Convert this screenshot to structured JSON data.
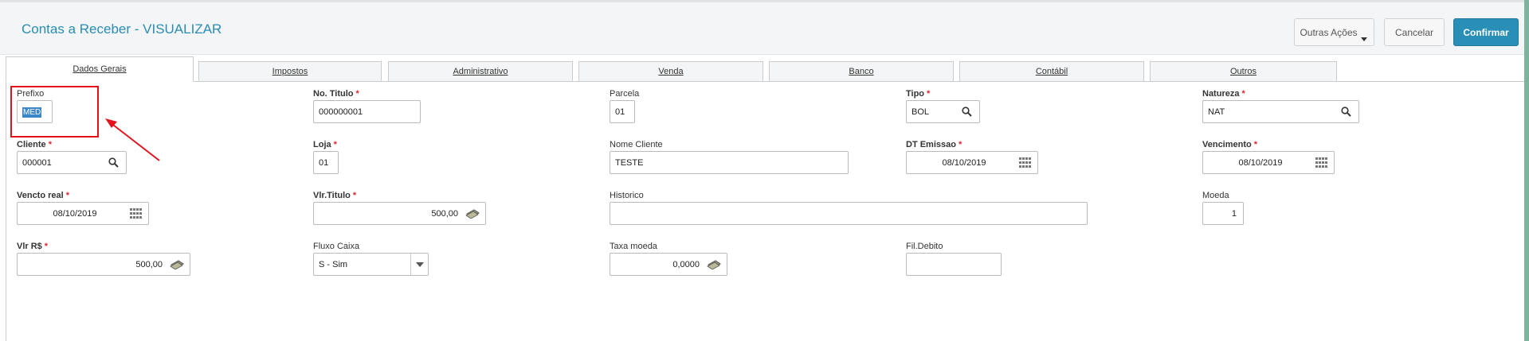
{
  "header": {
    "title": "Contas a Receber - VISUALIZAR",
    "outras_acoes": "Outras Ações",
    "cancelar": "Cancelar",
    "confirmar": "Confirmar"
  },
  "tabs": [
    {
      "label": "Dados Gerais",
      "active": true
    },
    {
      "label": "Impostos"
    },
    {
      "label": "Administrativo"
    },
    {
      "label": "Venda"
    },
    {
      "label": "Banco"
    },
    {
      "label": "Contábil"
    },
    {
      "label": "Outros"
    }
  ],
  "form": {
    "prefixo": {
      "label": "Prefixo",
      "value": "MED"
    },
    "no_titulo": {
      "label": "No. Titulo",
      "value": "000000001",
      "required": true
    },
    "parcela": {
      "label": "Parcela",
      "value": "01"
    },
    "tipo": {
      "label": "Tipo",
      "value": "BOL",
      "required": true,
      "icon": "search-icon"
    },
    "natureza": {
      "label": "Natureza",
      "value": "NAT",
      "required": true,
      "icon": "search-icon"
    },
    "cliente": {
      "label": "Cliente",
      "value": "000001",
      "required": true,
      "icon": "search-icon"
    },
    "loja": {
      "label": "Loja",
      "value": "01",
      "required": true
    },
    "nome_cliente": {
      "label": "Nome Cliente",
      "value": "TESTE"
    },
    "dt_emissao": {
      "label": "DT Emissao",
      "value": "08/10/2019",
      "required": true,
      "icon": "calendar-icon"
    },
    "vencimento": {
      "label": "Vencimento",
      "value": "08/10/2019",
      "required": true,
      "icon": "calendar-icon"
    },
    "vencto_real": {
      "label": "Vencto real",
      "value": "08/10/2019",
      "required": true,
      "icon": "calendar-icon"
    },
    "vlr_titulo": {
      "label": "Vlr.Titulo",
      "value": "500,00",
      "required": true,
      "icon": "money-icon"
    },
    "historico": {
      "label": "Historico",
      "value": ""
    },
    "moeda": {
      "label": "Moeda",
      "value": "1"
    },
    "vlr_rs": {
      "label": "Vlr R$",
      "value": "500,00",
      "required": true,
      "icon": "money-icon"
    },
    "fluxo_caixa": {
      "label": "Fluxo Caixa",
      "value": "S - Sim"
    },
    "taxa_moeda": {
      "label": "Taxa moeda",
      "value": "0,0000",
      "icon": "money-icon"
    },
    "fil_debito": {
      "label": "Fil.Debito",
      "value": ""
    }
  },
  "required_mark": "*",
  "colors": {
    "accent": "#2a8fb7",
    "highlight_box": "#e3121b",
    "required": "#e0242f"
  }
}
